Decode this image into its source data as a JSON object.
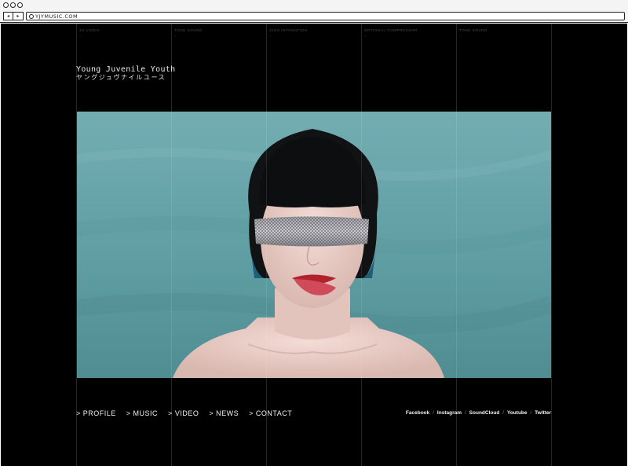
{
  "browser": {
    "url": "YJYMUSIC.COM",
    "back_glyph": "◂",
    "forward_glyph": "▸"
  },
  "columns": [
    {
      "label": "3D VIDEO",
      "sub": "--"
    },
    {
      "label": "TONE SOUND",
      "sub": "–"
    },
    {
      "label": "SIGN INTONATION",
      "sub": "–"
    },
    {
      "label": "OPTIONAL COMPRESSOR",
      "sub": "–"
    },
    {
      "label": "TONE SOUND",
      "sub": "–"
    }
  ],
  "brand": {
    "name_en": "Young Juvenile Youth",
    "name_jp": "ヤングジュヴナイルユース"
  },
  "hero": {
    "description_icon": "portrait-image",
    "background_color": "#6aa7ac"
  },
  "nav": {
    "arrow": ">",
    "items": [
      {
        "label": "PROFILE"
      },
      {
        "label": "MUSIC"
      },
      {
        "label": "VIDEO"
      },
      {
        "label": "NEWS"
      },
      {
        "label": "CONTACT"
      }
    ]
  },
  "social": {
    "separator": "/",
    "items": [
      {
        "label": "Facebook"
      },
      {
        "label": "Instagram"
      },
      {
        "label": "SoundCloud"
      },
      {
        "label": "Youtube"
      },
      {
        "label": "Twitter"
      }
    ]
  },
  "colors": {
    "page_background": "#000000",
    "text": "#f2f2f2",
    "hero_teal": "#6aa7ac"
  }
}
